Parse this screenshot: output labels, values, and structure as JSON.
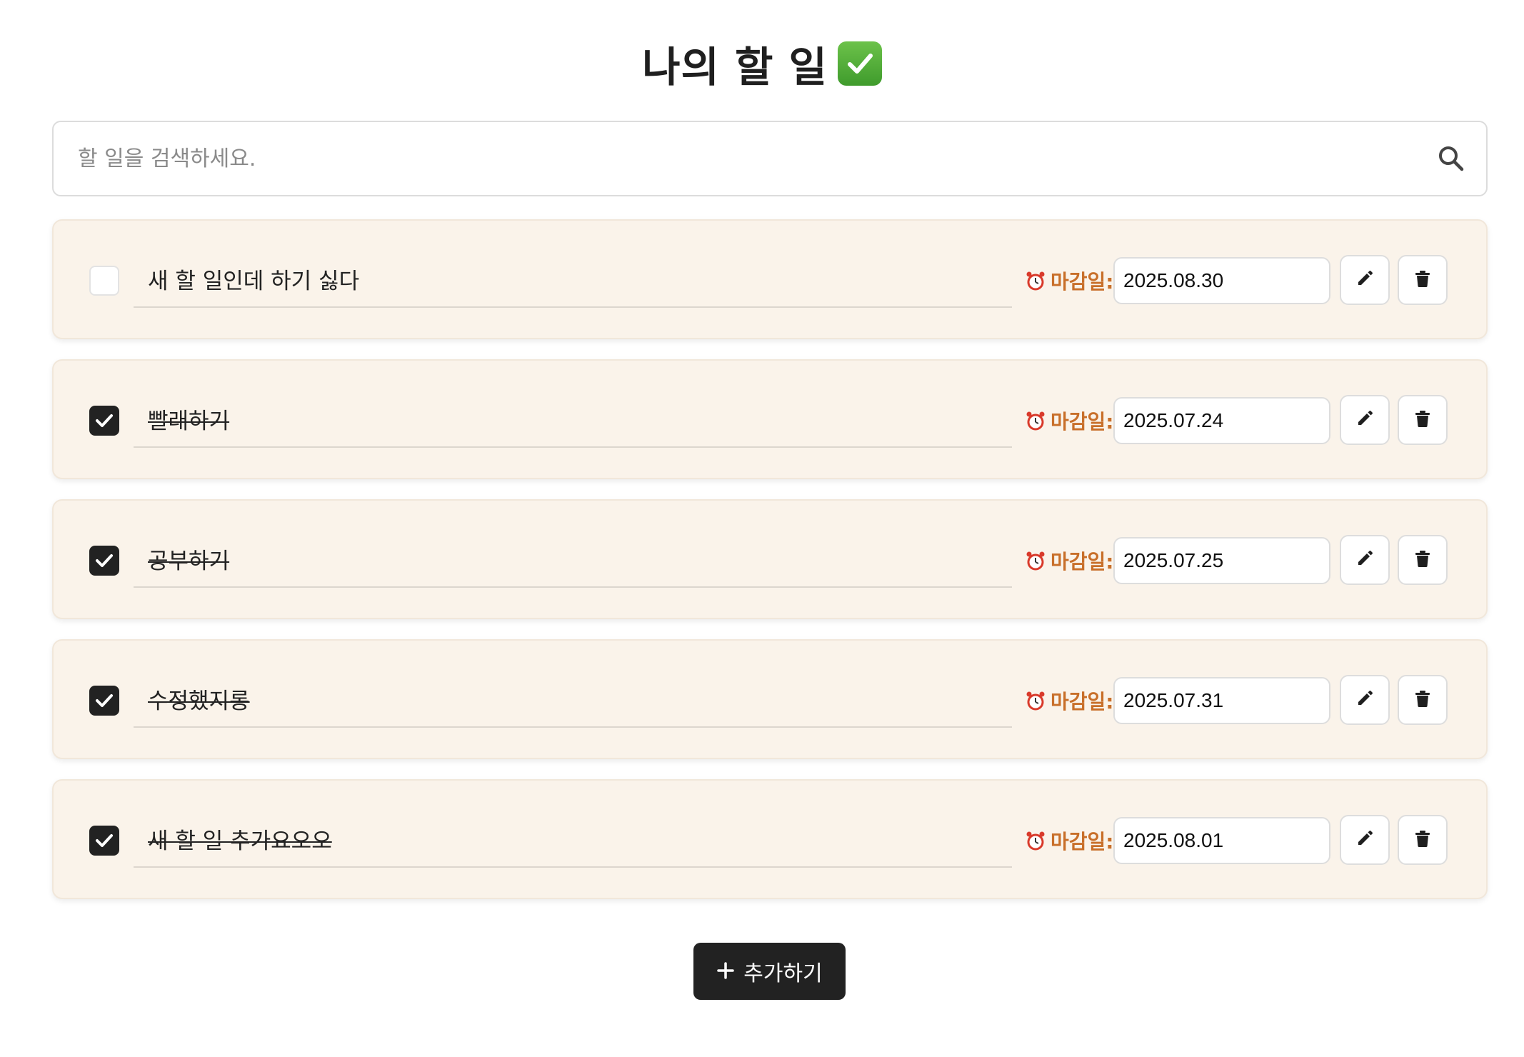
{
  "header": {
    "title": "나의 할 일",
    "title_emoji": "check-mark-button-icon"
  },
  "search": {
    "placeholder": "할 일을 검색하세요.",
    "value": "",
    "icon": "search-icon"
  },
  "todos": [
    {
      "text": "새 할 일인데 하기 싫다",
      "completed": false,
      "due_label": "마감일:",
      "due_date": "2025.08.30"
    },
    {
      "text": "빨래하기",
      "completed": true,
      "due_label": "마감일:",
      "due_date": "2025.07.24"
    },
    {
      "text": "공부하기",
      "completed": true,
      "due_label": "마감일:",
      "due_date": "2025.07.25"
    },
    {
      "text": "수정했지롱",
      "completed": true,
      "due_label": "마감일:",
      "due_date": "2025.07.31"
    },
    {
      "text": "새 할 일 추가요오오",
      "completed": true,
      "due_label": "마감일:",
      "due_date": "2025.08.01"
    }
  ],
  "icons": {
    "due": "alarm-clock-icon",
    "edit": "pencil-icon",
    "delete": "trash-icon",
    "add": "plus-icon"
  },
  "add_button": {
    "label": "추가하기"
  },
  "colors": {
    "card_background": "#faf3ea",
    "accent_due": "#c86f2a",
    "primary_dark": "#222222",
    "title_check_green": "#4caf3a"
  }
}
